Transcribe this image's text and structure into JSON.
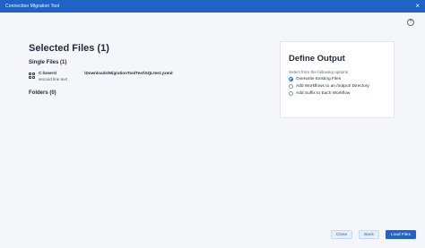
{
  "window": {
    "title": "Connection Migration Tool",
    "close_glyph": "×",
    "help_glyph": "?"
  },
  "selected": {
    "title": "Selected Files (1)",
    "single_files_label": "Single Files (1)",
    "files": [
      {
        "path_start": "C:\\Users\\",
        "path_end": "\\Downloads\\MigrationToolTest\\SQLtest.yxmd",
        "subtext": "second line text"
      }
    ],
    "folders_label": "Folders (0)"
  },
  "output": {
    "title": "Define Output",
    "description": "Select from the following options",
    "options": [
      {
        "label": "Overwrite Existing Files",
        "checked": true
      },
      {
        "label": "Add Workflows to an /output/ Directory",
        "checked": false
      },
      {
        "label": "Add Suffix to Each Workflow",
        "checked": false
      }
    ]
  },
  "footer": {
    "close_label": "Close",
    "back_label": "Back",
    "load_label": "Load Files"
  },
  "colors": {
    "accent": "#1f63c6",
    "background": "#f4f6f9"
  }
}
